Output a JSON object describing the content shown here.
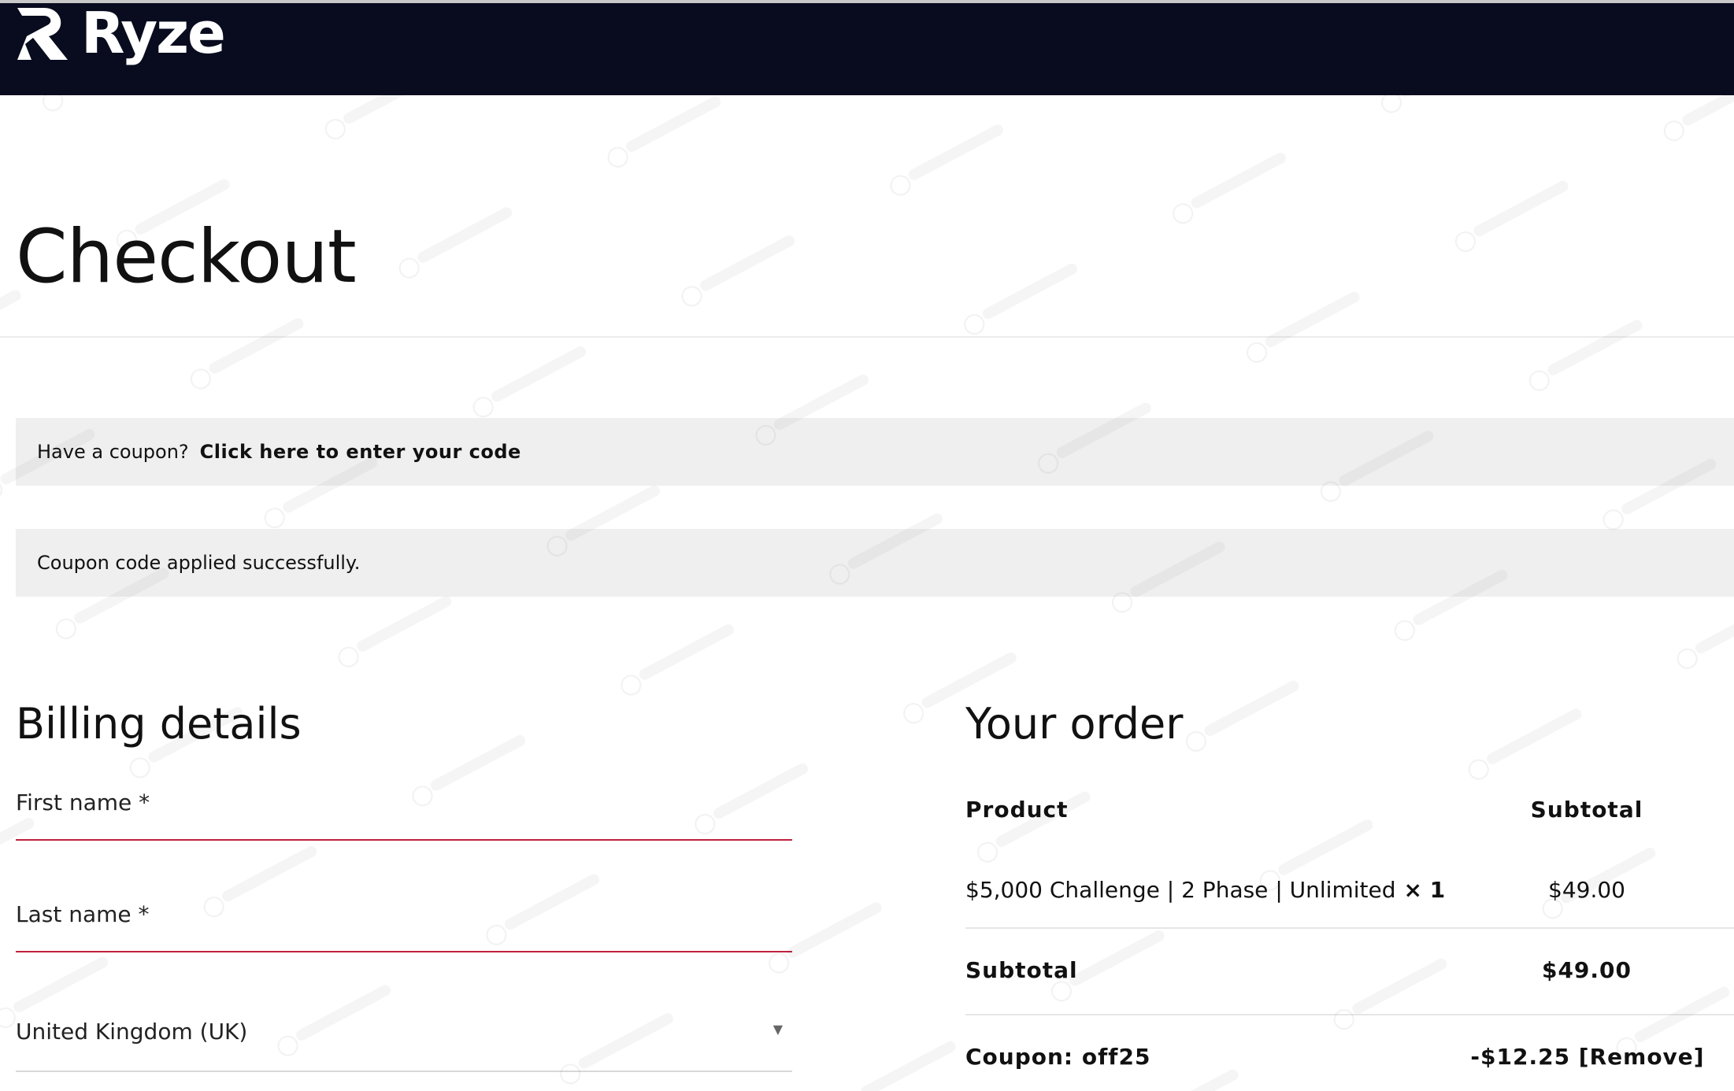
{
  "header": {
    "brand": "Ryze",
    "bg_color": "#090c1f"
  },
  "page": {
    "title": "Checkout"
  },
  "coupon_notice": {
    "prompt": "Have a coupon?",
    "link": "Click here to enter your code"
  },
  "applied_notice": {
    "message": "Coupon code applied successfully."
  },
  "billing": {
    "title": "Billing details",
    "first_name_label": "First name *",
    "last_name_label": "Last name *",
    "country_value": "United Kingdom (UK)"
  },
  "order": {
    "title": "Your order",
    "col_product": "Product",
    "col_subtotal": "Subtotal",
    "item_name": "$5,000 Challenge | 2 Phase | Unlimited",
    "item_qty": "× 1",
    "item_price": "$49.00",
    "subtotal_label": "Subtotal",
    "subtotal_value": "$49.00",
    "coupon_label": "Coupon: off25",
    "coupon_discount": "-$12.25",
    "coupon_remove": "[Remove]"
  },
  "colors": {
    "accent_field_line": "#c0223f",
    "notice_bg": "#efefef"
  }
}
